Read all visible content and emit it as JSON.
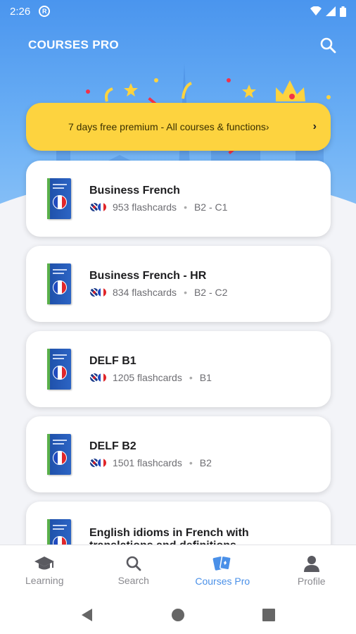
{
  "status_bar": {
    "time": "2:26"
  },
  "app_bar": {
    "title": "COURSES PRO",
    "search_icon": "search-icon"
  },
  "promo": {
    "text": "7 days free premium - All courses & functions›",
    "arrow": "›",
    "color": "#fdd33f"
  },
  "courses": [
    {
      "title": "Business French",
      "flashcards": "953 flashcards",
      "level": "B2 - C1"
    },
    {
      "title": "Business French - HR",
      "flashcards": "834 flashcards",
      "level": "B2 - C2"
    },
    {
      "title": "DELF B1",
      "flashcards": "1205 flashcards",
      "level": "B1"
    },
    {
      "title": "DELF B2",
      "flashcards": "1501 flashcards",
      "level": "B2"
    },
    {
      "title": "English idioms in French with translations and definitions",
      "flashcards": "",
      "level": ""
    }
  ],
  "bottom_nav": {
    "items": [
      {
        "label": "Learning",
        "icon": "graduation-cap-icon"
      },
      {
        "label": "Search",
        "icon": "search-icon"
      },
      {
        "label": "Courses Pro",
        "icon": "cards-icon"
      },
      {
        "label": "Profile",
        "icon": "person-icon"
      }
    ],
    "active_color": "#4a90e8"
  },
  "accent_color": "#4a95ee"
}
